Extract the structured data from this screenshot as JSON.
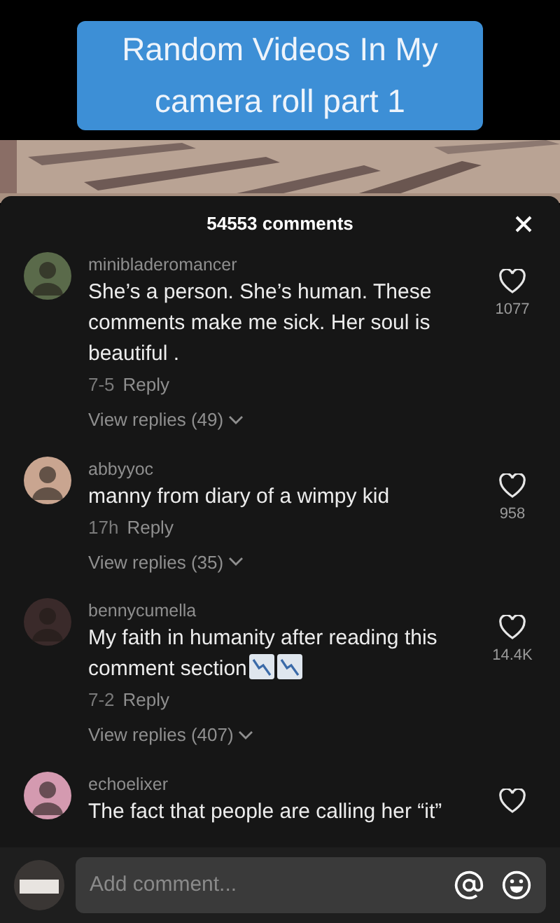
{
  "caption": "Random Videos In My camera roll part 1",
  "comments_panel": {
    "title": "54553 comments",
    "comments": [
      {
        "username": "minibladeromancer",
        "text": "She’s a person. She’s human. These comments make me sick. Her soul is beautiful .",
        "date": "7-5",
        "reply": "Reply",
        "view_replies": "View replies (49)",
        "likes": "1077"
      },
      {
        "username": "abbyyoc",
        "text": "manny from diary of a wimpy kid",
        "date": "17h",
        "reply": "Reply",
        "view_replies": "View replies (35)",
        "likes": "958"
      },
      {
        "username": "bennycumella",
        "text": "My faith in humanity after reading this comment section",
        "trailing_icons": [
          {
            "kind": "chart-down"
          },
          {
            "kind": "chart-down"
          }
        ],
        "date": "7-2",
        "reply": "Reply",
        "view_replies": "View replies (407)",
        "likes": "14.4K"
      },
      {
        "username": "echoelixer",
        "text": "The fact that people are calling her “it”"
      }
    ]
  },
  "comment_bar": {
    "placeholder": "Add comment..."
  }
}
